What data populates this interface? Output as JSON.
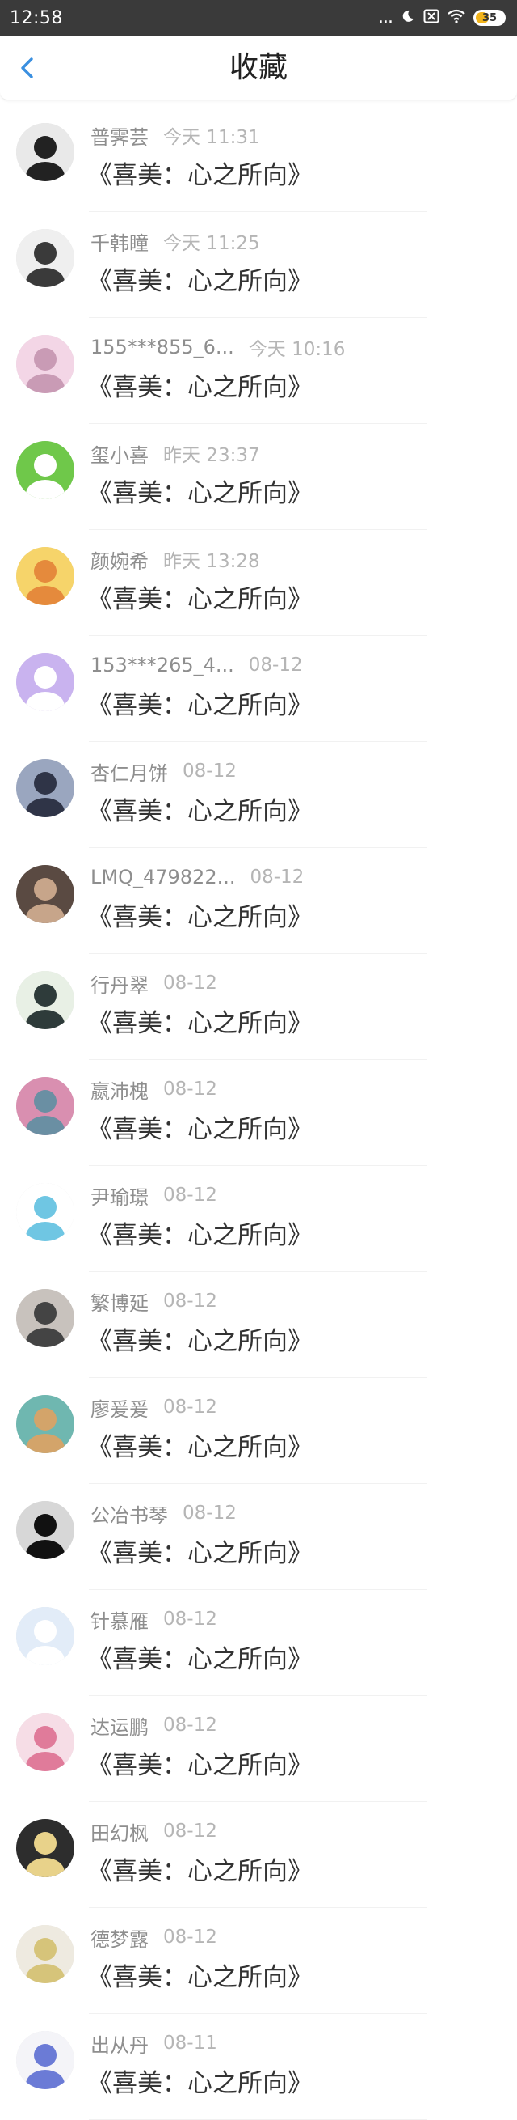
{
  "status": {
    "time": "12:58",
    "signal_dots": "...",
    "battery": "35"
  },
  "header": {
    "title": "收藏"
  },
  "items": [
    {
      "name": "普霁芸",
      "time": "今天 11:31",
      "title": "《喜美：心之所向》",
      "avatar_bg": "#e9e9e9",
      "avatar_fg": "#222222"
    },
    {
      "name": "千韩瞳",
      "time": "今天 11:25",
      "title": "《喜美：心之所向》",
      "avatar_bg": "#efefef",
      "avatar_fg": "#3a3a3a"
    },
    {
      "name": "155***855_6...",
      "time": "今天 10:16",
      "title": "《喜美：心之所向》",
      "avatar_bg": "#f3d6e6",
      "avatar_fg": "#c99bb5"
    },
    {
      "name": "玺小喜",
      "time": "昨天 23:37",
      "title": "《喜美：心之所向》",
      "avatar_bg": "#6fc84a",
      "avatar_fg": "#ffffff"
    },
    {
      "name": "颜婉希",
      "time": "昨天 13:28",
      "title": "《喜美：心之所向》",
      "avatar_bg": "#f6d46a",
      "avatar_fg": "#e58a3c"
    },
    {
      "name": "153***265_4...",
      "time": "08-12",
      "title": "《喜美：心之所向》",
      "avatar_bg": "#c9b3ef",
      "avatar_fg": "#ffffff"
    },
    {
      "name": "杏仁月饼",
      "time": "08-12",
      "title": "《喜美：心之所向》",
      "avatar_bg": "#9aa6bf",
      "avatar_fg": "#2f3447"
    },
    {
      "name": "LMQ_479822...",
      "time": "08-12",
      "title": "《喜美：心之所向》",
      "avatar_bg": "#5a4a42",
      "avatar_fg": "#c7a58a"
    },
    {
      "name": "行丹翠",
      "time": "08-12",
      "title": "《喜美：心之所向》",
      "avatar_bg": "#e8f0e5",
      "avatar_fg": "#2e3b3a"
    },
    {
      "name": "嬴沛槐",
      "time": "08-12",
      "title": "《喜美：心之所向》",
      "avatar_bg": "#d98fb0",
      "avatar_fg": "#6a8fa3"
    },
    {
      "name": "尹瑜璟",
      "time": "08-12",
      "title": "《喜美：心之所向》",
      "avatar_bg": "#ffffff",
      "avatar_fg": "#6fc6e3"
    },
    {
      "name": "繁博延",
      "time": "08-12",
      "title": "《喜美：心之所向》",
      "avatar_bg": "#c8c2bd",
      "avatar_fg": "#444444"
    },
    {
      "name": "廖爰爰",
      "time": "08-12",
      "title": "《喜美：心之所向》",
      "avatar_bg": "#6fb7b0",
      "avatar_fg": "#d3a46a"
    },
    {
      "name": "公冶书琴",
      "time": "08-12",
      "title": "《喜美：心之所向》",
      "avatar_bg": "#d7d7d7",
      "avatar_fg": "#111111"
    },
    {
      "name": "针慕雁",
      "time": "08-12",
      "title": "《喜美：心之所向》",
      "avatar_bg": "#e2ecf8",
      "avatar_fg": "#ffffff"
    },
    {
      "name": "达运鹏",
      "time": "08-12",
      "title": "《喜美：心之所向》",
      "avatar_bg": "#f6dde6",
      "avatar_fg": "#e07b9a"
    },
    {
      "name": "田幻枫",
      "time": "08-12",
      "title": "《喜美：心之所向》",
      "avatar_bg": "#2d2d2d",
      "avatar_fg": "#e8d28a"
    },
    {
      "name": "德梦露",
      "time": "08-12",
      "title": "《喜美：心之所向》",
      "avatar_bg": "#eeeae0",
      "avatar_fg": "#d6c47a"
    },
    {
      "name": "出从丹",
      "time": "08-11",
      "title": "《喜美：心之所向》",
      "avatar_bg": "#f4f4f8",
      "avatar_fg": "#6b7bd6"
    }
  ]
}
